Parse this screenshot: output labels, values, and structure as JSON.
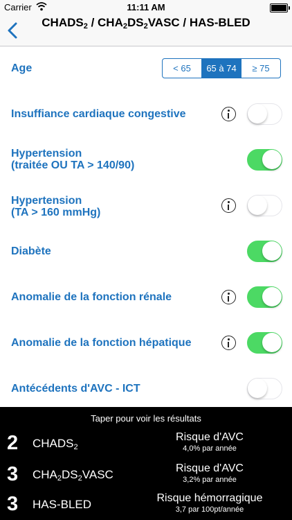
{
  "status_bar": {
    "carrier": "Carrier",
    "time": "11:11 AM"
  },
  "nav": {
    "title_parts": [
      "CHADS",
      "2",
      " / CHA",
      "2",
      "DS",
      "2",
      "VASC / HAS-BLED"
    ]
  },
  "age": {
    "label": "Age",
    "options": [
      "< 65",
      "65 à 74",
      "≥ 75"
    ],
    "selected": "65 à 74"
  },
  "criteria": [
    {
      "label_lines": [
        "Insuffiance cardiaque congestive"
      ],
      "info": true,
      "on": false
    },
    {
      "label_lines": [
        "Hypertension",
        "(traitée OU TA > 140/90)"
      ],
      "info": false,
      "on": true
    },
    {
      "label_lines": [
        "Hypertension",
        "(TA > 160 mmHg)"
      ],
      "info": true,
      "on": false
    },
    {
      "label_lines": [
        "Diabète"
      ],
      "info": false,
      "on": true
    },
    {
      "label_lines": [
        "Anomalie de la fonction rénale"
      ],
      "info": true,
      "on": true
    },
    {
      "label_lines": [
        "Anomalie de la fonction hépatique"
      ],
      "info": true,
      "on": true
    },
    {
      "label_lines": [
        "Antécédents d'AVC - ICT"
      ],
      "info": false,
      "on": false
    }
  ],
  "results": {
    "hint": "Taper pour voir les résultats",
    "rows": [
      {
        "score": "2",
        "name_parts": [
          "CHADS",
          "2"
        ],
        "risk_label": "Risque d'AVC",
        "risk_value": "4,0% par année"
      },
      {
        "score": "3",
        "name_parts": [
          "CHA",
          "2",
          "DS",
          "2",
          "VASC"
        ],
        "risk_label": "Risque d'AVC",
        "risk_value": "3,2% par année"
      },
      {
        "score": "3",
        "name_parts": [
          "HAS-BLED"
        ],
        "risk_label": "Risque hémorragique",
        "risk_value": "3,7 par 100pt/année"
      }
    ]
  },
  "colors": {
    "accent": "#1e73be",
    "toggle_on": "#4cd964",
    "results_bg": "#000000"
  },
  "icons": {
    "back": "chevron-left-icon",
    "info": "info-icon",
    "wifi": "wifi-icon",
    "battery": "battery-icon"
  }
}
